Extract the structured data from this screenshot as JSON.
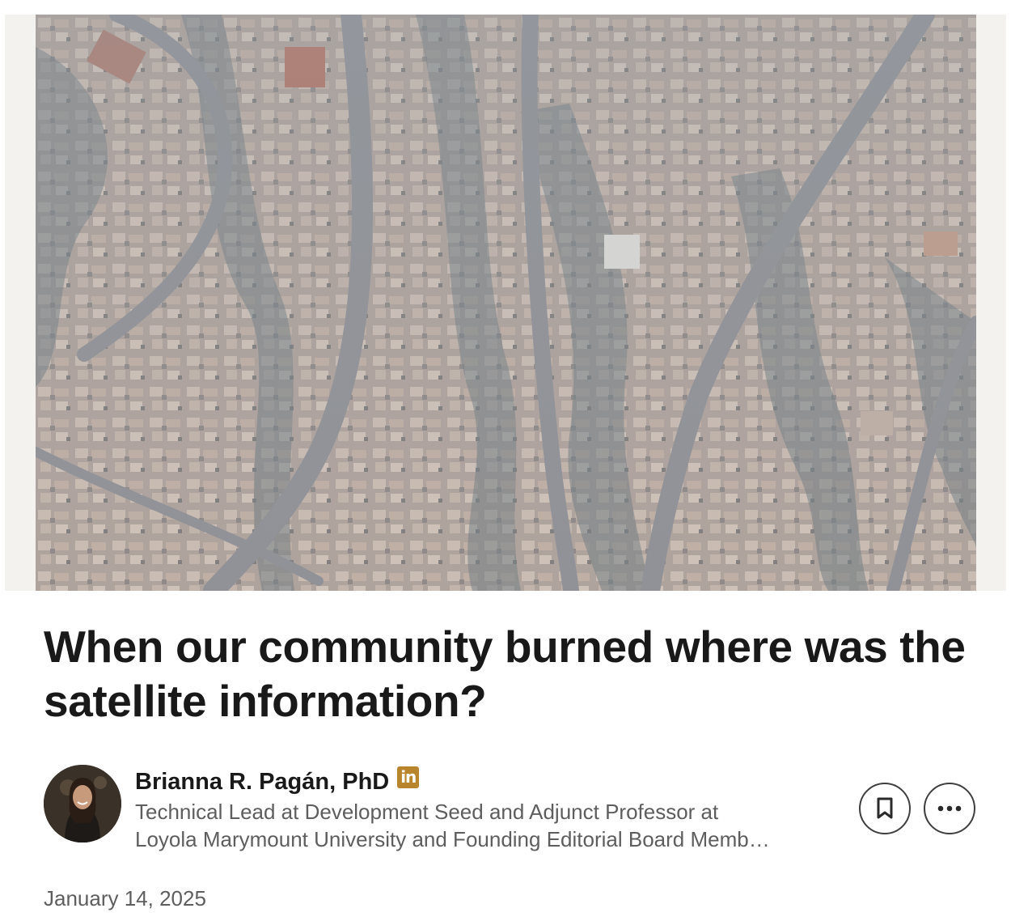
{
  "article": {
    "title": "When our community burned where was the satellite information?",
    "hero_image_alt": "",
    "published_date": "January 14, 2025"
  },
  "author": {
    "name": "Brianna R. Pagán, PhD",
    "headline_line1": "Technical Lead at Development Seed and Adjunct Professor at",
    "headline_line2": "Loyola Marymount University and Founding Editorial Board Memb…",
    "badge_text": "in"
  },
  "actions": {
    "save_icon": "bookmark-icon",
    "more_icon": "ellipsis-icon"
  },
  "colors": {
    "badge": "#b8842c",
    "title": "#191919",
    "secondary_text": "#5e5e5e"
  }
}
